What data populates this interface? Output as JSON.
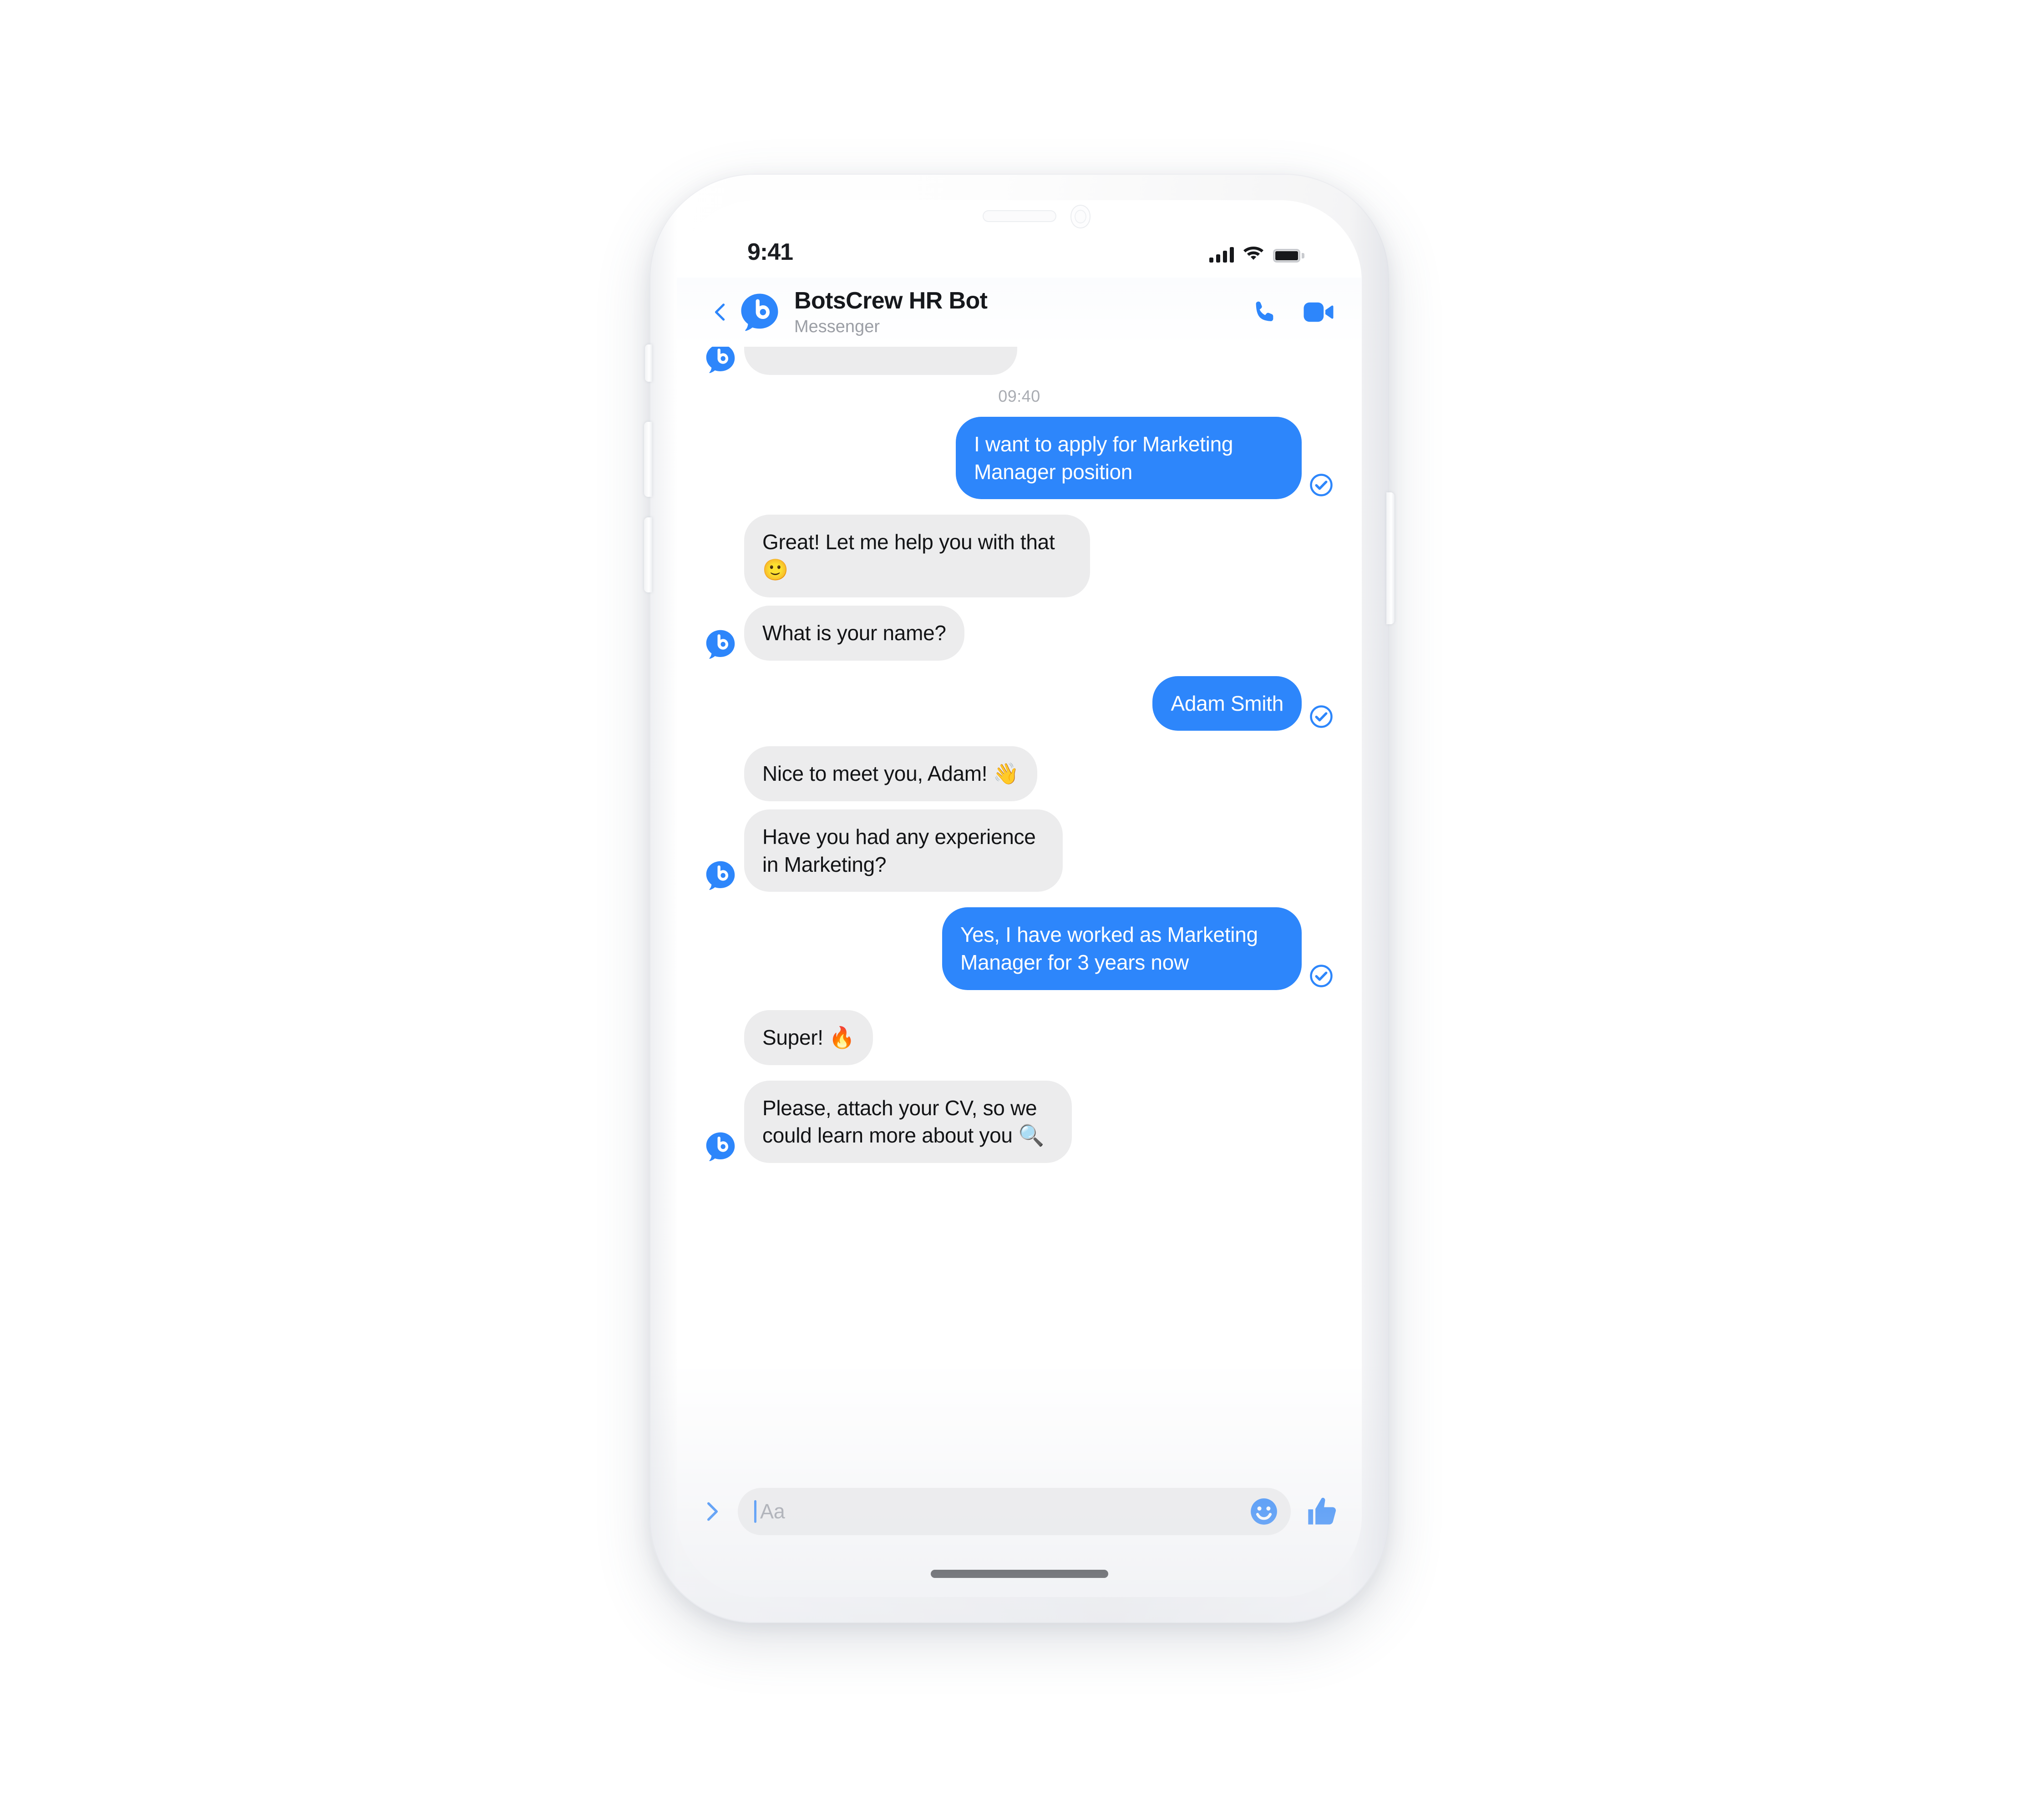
{
  "colors": {
    "accent_blue": "#2d86fb",
    "bot_bubble": "#ececed",
    "bot_bubble_text": "#131416",
    "me_bubble_text": "#ffffff",
    "muted_text": "#9b9ea5",
    "screen_bg": "#ffffff",
    "phone_body": "#ffffff"
  },
  "status_bar": {
    "time": "9:41",
    "signal_icon": "cellular-signal-icon",
    "wifi_icon": "wifi-icon",
    "battery_icon": "battery-full-icon"
  },
  "header": {
    "back_icon": "chevron-left-icon",
    "avatar_icon": "botscrew-bot-avatar-icon",
    "title": "BotsCrew HR Bot",
    "subtitle": "Messenger",
    "call_icon": "phone-call-icon",
    "video_icon": "video-camera-icon"
  },
  "conversation": {
    "timestamp": "09:40",
    "delivered_icon": "check-circle-icon",
    "messages": [
      {
        "from": "bot",
        "text": "",
        "clipped": true,
        "avatar": true
      },
      {
        "from": "me",
        "text": "I want to apply for Marketing Manager position",
        "delivered": true
      },
      {
        "from": "bot",
        "text": "Great! Let me help you with that 🙂",
        "avatar": false
      },
      {
        "from": "bot",
        "text": "What is your name?",
        "avatar": true
      },
      {
        "from": "me",
        "text": "Adam Smith",
        "delivered": true
      },
      {
        "from": "bot",
        "text": "Nice to meet you, Adam! 👋",
        "avatar": false
      },
      {
        "from": "bot",
        "text": "Have you had any experience in Marketing?",
        "avatar": true
      },
      {
        "from": "me",
        "text": "Yes, I have worked as Marketing Manager for 3 years now",
        "delivered": true
      },
      {
        "from": "bot",
        "text": "Super! 🔥",
        "avatar": false
      },
      {
        "from": "bot",
        "text": "Please, attach your CV, so we could learn more about you 🔍",
        "avatar": true
      }
    ]
  },
  "composer": {
    "expand_icon": "chevron-right-icon",
    "placeholder": "Aa",
    "value": "",
    "emoji_icon": "smiley-face-icon",
    "like_icon": "thumbs-up-icon"
  },
  "device": {
    "speaker_icon": "earpiece-speaker",
    "camera_icon": "front-camera",
    "home_indicator": "home-indicator",
    "silent_switch": "silent-switch-button",
    "volume_up": "volume-up-button",
    "volume_down": "volume-down-button",
    "power": "power-button"
  }
}
